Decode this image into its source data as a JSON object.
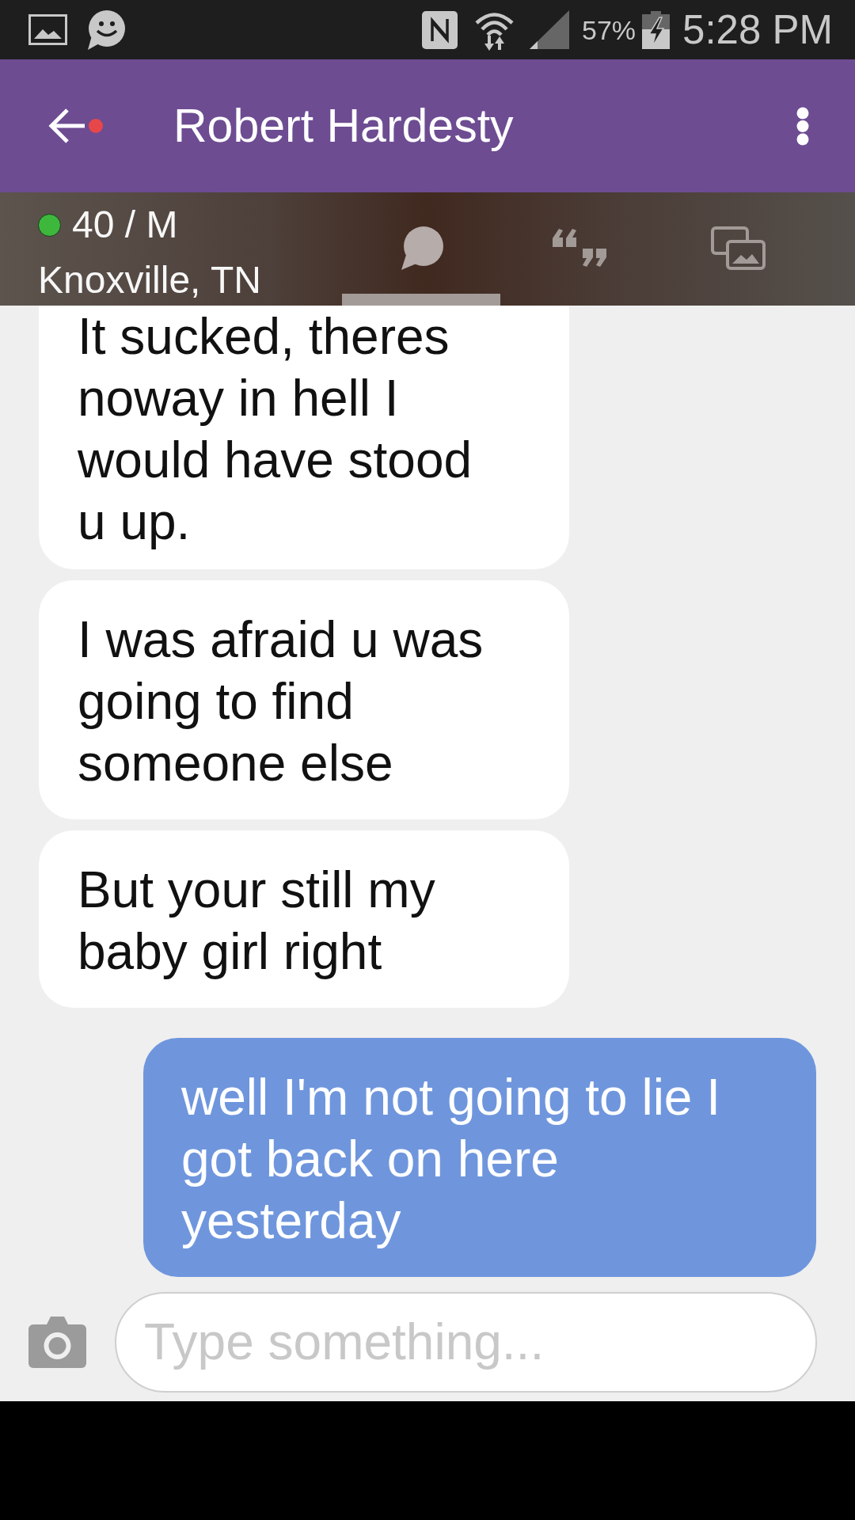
{
  "status_bar": {
    "battery_percent": "57%",
    "battery_charging": true,
    "time": "5:28 PM"
  },
  "header": {
    "title": "Robert Hardesty",
    "unread_indicator": true
  },
  "profile": {
    "online": true,
    "age_gender": "40 / M",
    "location": "Knoxville, TN"
  },
  "tabs": [
    {
      "kind": "chat",
      "selected": true
    },
    {
      "kind": "quotes",
      "selected": false
    },
    {
      "kind": "photos",
      "selected": false
    }
  ],
  "messages": [
    {
      "kind": "received",
      "text": "It sucked, theres noway in hell I would have stood u up."
    },
    {
      "kind": "received",
      "text": "I was afraid u was going to find someone else"
    },
    {
      "kind": "received",
      "text": "But your still my baby girl right"
    },
    {
      "kind": "sent",
      "text": "well I'm not going to lie I got back on here yesterday"
    }
  ],
  "composer": {
    "placeholder": "Type something..."
  }
}
